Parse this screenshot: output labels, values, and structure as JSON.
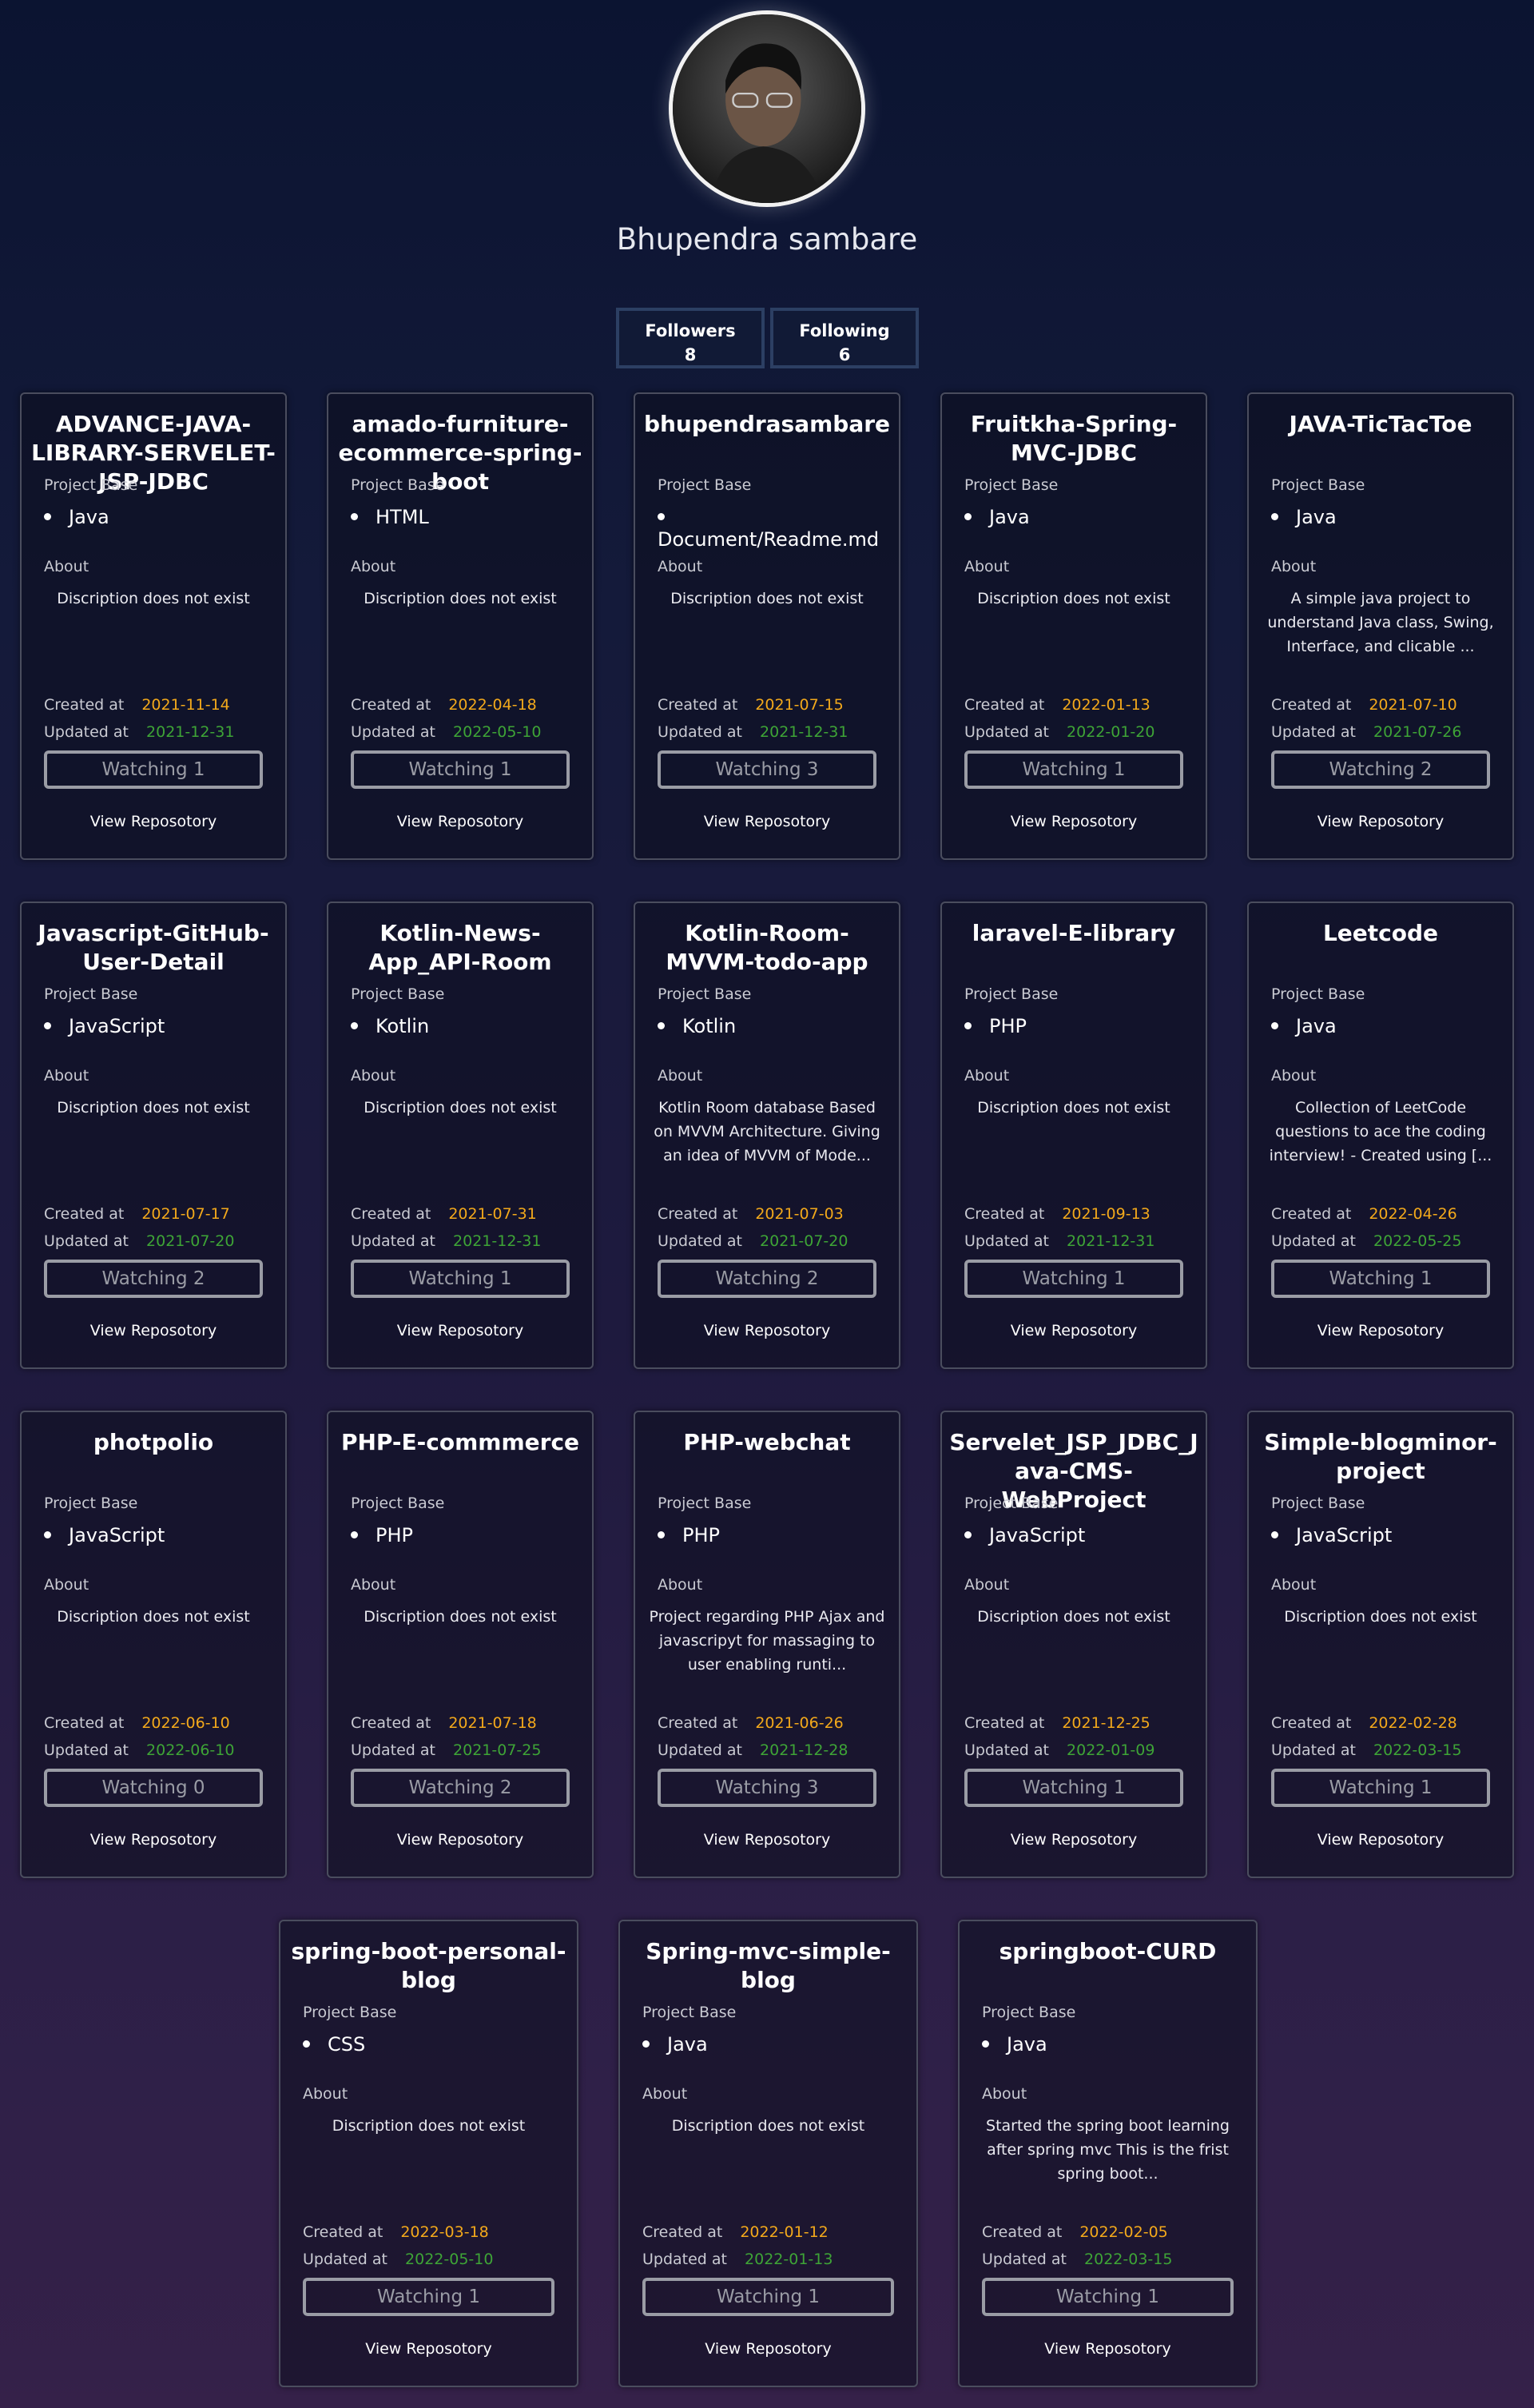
{
  "profile": {
    "name": "Bhupendra sambare",
    "followers_label": "Followers",
    "followers_count": "8",
    "following_label": "Following",
    "following_count": "6"
  },
  "labels": {
    "project_base": "Project Base",
    "about": "About",
    "created_at": "Created at",
    "updated_at": "Updated at",
    "watching": "Watching",
    "view_repo": "View Reposotory"
  },
  "colors": {
    "created": "#f3a91b",
    "updated": "#3ea436",
    "card_border": "#4a4d5e"
  },
  "repos": [
    {
      "name": "ADVANCE-JAVA-LIBRARY-SERVELET-JSP-JDBC",
      "base": "Java",
      "about": "Discription does not exist",
      "created": "2021-11-14",
      "updated": "2021-12-31",
      "watching": "Watching 1"
    },
    {
      "name": "amado-furniture-ecommerce-spring-boot",
      "base": "HTML",
      "about": "Discription does not exist",
      "created": "2022-04-18",
      "updated": "2022-05-10",
      "watching": "Watching 1"
    },
    {
      "name": "bhupendrasambare",
      "base": "Document/Readme.md",
      "about": "Discription does not exist",
      "created": "2021-07-15",
      "updated": "2021-12-31",
      "watching": "Watching 3"
    },
    {
      "name": "Fruitkha-Spring-MVC-JDBC",
      "base": "Java",
      "about": "Discription does not exist",
      "created": "2022-01-13",
      "updated": "2022-01-20",
      "watching": "Watching 1"
    },
    {
      "name": "JAVA-TicTacToe",
      "base": "Java",
      "about": "A simple java project to understand Java class, Swing, Interface, and clicable ...",
      "created": "2021-07-10",
      "updated": "2021-07-26",
      "watching": "Watching 2"
    },
    {
      "name": "Javascript-GitHub-User-Detail",
      "base": "JavaScript",
      "about": "Discription does not exist",
      "created": "2021-07-17",
      "updated": "2021-07-20",
      "watching": "Watching 2"
    },
    {
      "name": "Kotlin-News-App_API-Room",
      "base": "Kotlin",
      "about": "Discription does not exist",
      "created": "2021-07-31",
      "updated": "2021-12-31",
      "watching": "Watching 1"
    },
    {
      "name": "Kotlin-Room-MVVM-todo-app",
      "base": "Kotlin",
      "about": "Kotlin Room database Based on MVVM Architecture. Giving an idea of MVVM of Mode...",
      "created": "2021-07-03",
      "updated": "2021-07-20",
      "watching": "Watching 2"
    },
    {
      "name": "laravel-E-library",
      "base": "PHP",
      "about": "Discription does not exist",
      "created": "2021-09-13",
      "updated": "2021-12-31",
      "watching": "Watching 1"
    },
    {
      "name": "Leetcode",
      "base": "Java",
      "about": "Collection of LeetCode questions to ace the coding interview! - Created using [...",
      "created": "2022-04-26",
      "updated": "2022-05-25",
      "watching": "Watching 1"
    },
    {
      "name": "photpolio",
      "base": "JavaScript",
      "about": "Discription does not exist",
      "created": "2022-06-10",
      "updated": "2022-06-10",
      "watching": "Watching 0"
    },
    {
      "name": "PHP-E-commmerce",
      "base": "PHP",
      "about": "Discription does not exist",
      "created": "2021-07-18",
      "updated": "2021-07-25",
      "watching": "Watching 2"
    },
    {
      "name": "PHP-webchat",
      "base": "PHP",
      "about": "Project regarding PHP Ajax and javascripyt for massaging to user enabling runti...",
      "created": "2021-06-26",
      "updated": "2021-12-28",
      "watching": "Watching 3"
    },
    {
      "name": "Servelet_JSP_JDBC_Java-CMS-WebProject",
      "base": "JavaScript",
      "about": "Discription does not exist",
      "created": "2021-12-25",
      "updated": "2022-01-09",
      "watching": "Watching 1"
    },
    {
      "name": "Simple-blogminor-project",
      "base": "JavaScript",
      "about": "Discription does not exist",
      "created": "2022-02-28",
      "updated": "2022-03-15",
      "watching": "Watching 1"
    },
    {
      "name": "spring-boot-personal-blog",
      "base": "CSS",
      "about": "Discription does not exist",
      "created": "2022-03-18",
      "updated": "2022-05-10",
      "watching": "Watching 1"
    },
    {
      "name": "Spring-mvc-simple-blog",
      "base": "Java",
      "about": "Discription does not exist",
      "created": "2022-01-12",
      "updated": "2022-01-13",
      "watching": "Watching 1"
    },
    {
      "name": "springboot-CURD",
      "base": "Java",
      "about": "Started the spring boot learning after spring mvc This is the frist spring boot...",
      "created": "2022-02-05",
      "updated": "2022-03-15",
      "watching": "Watching 1"
    }
  ]
}
